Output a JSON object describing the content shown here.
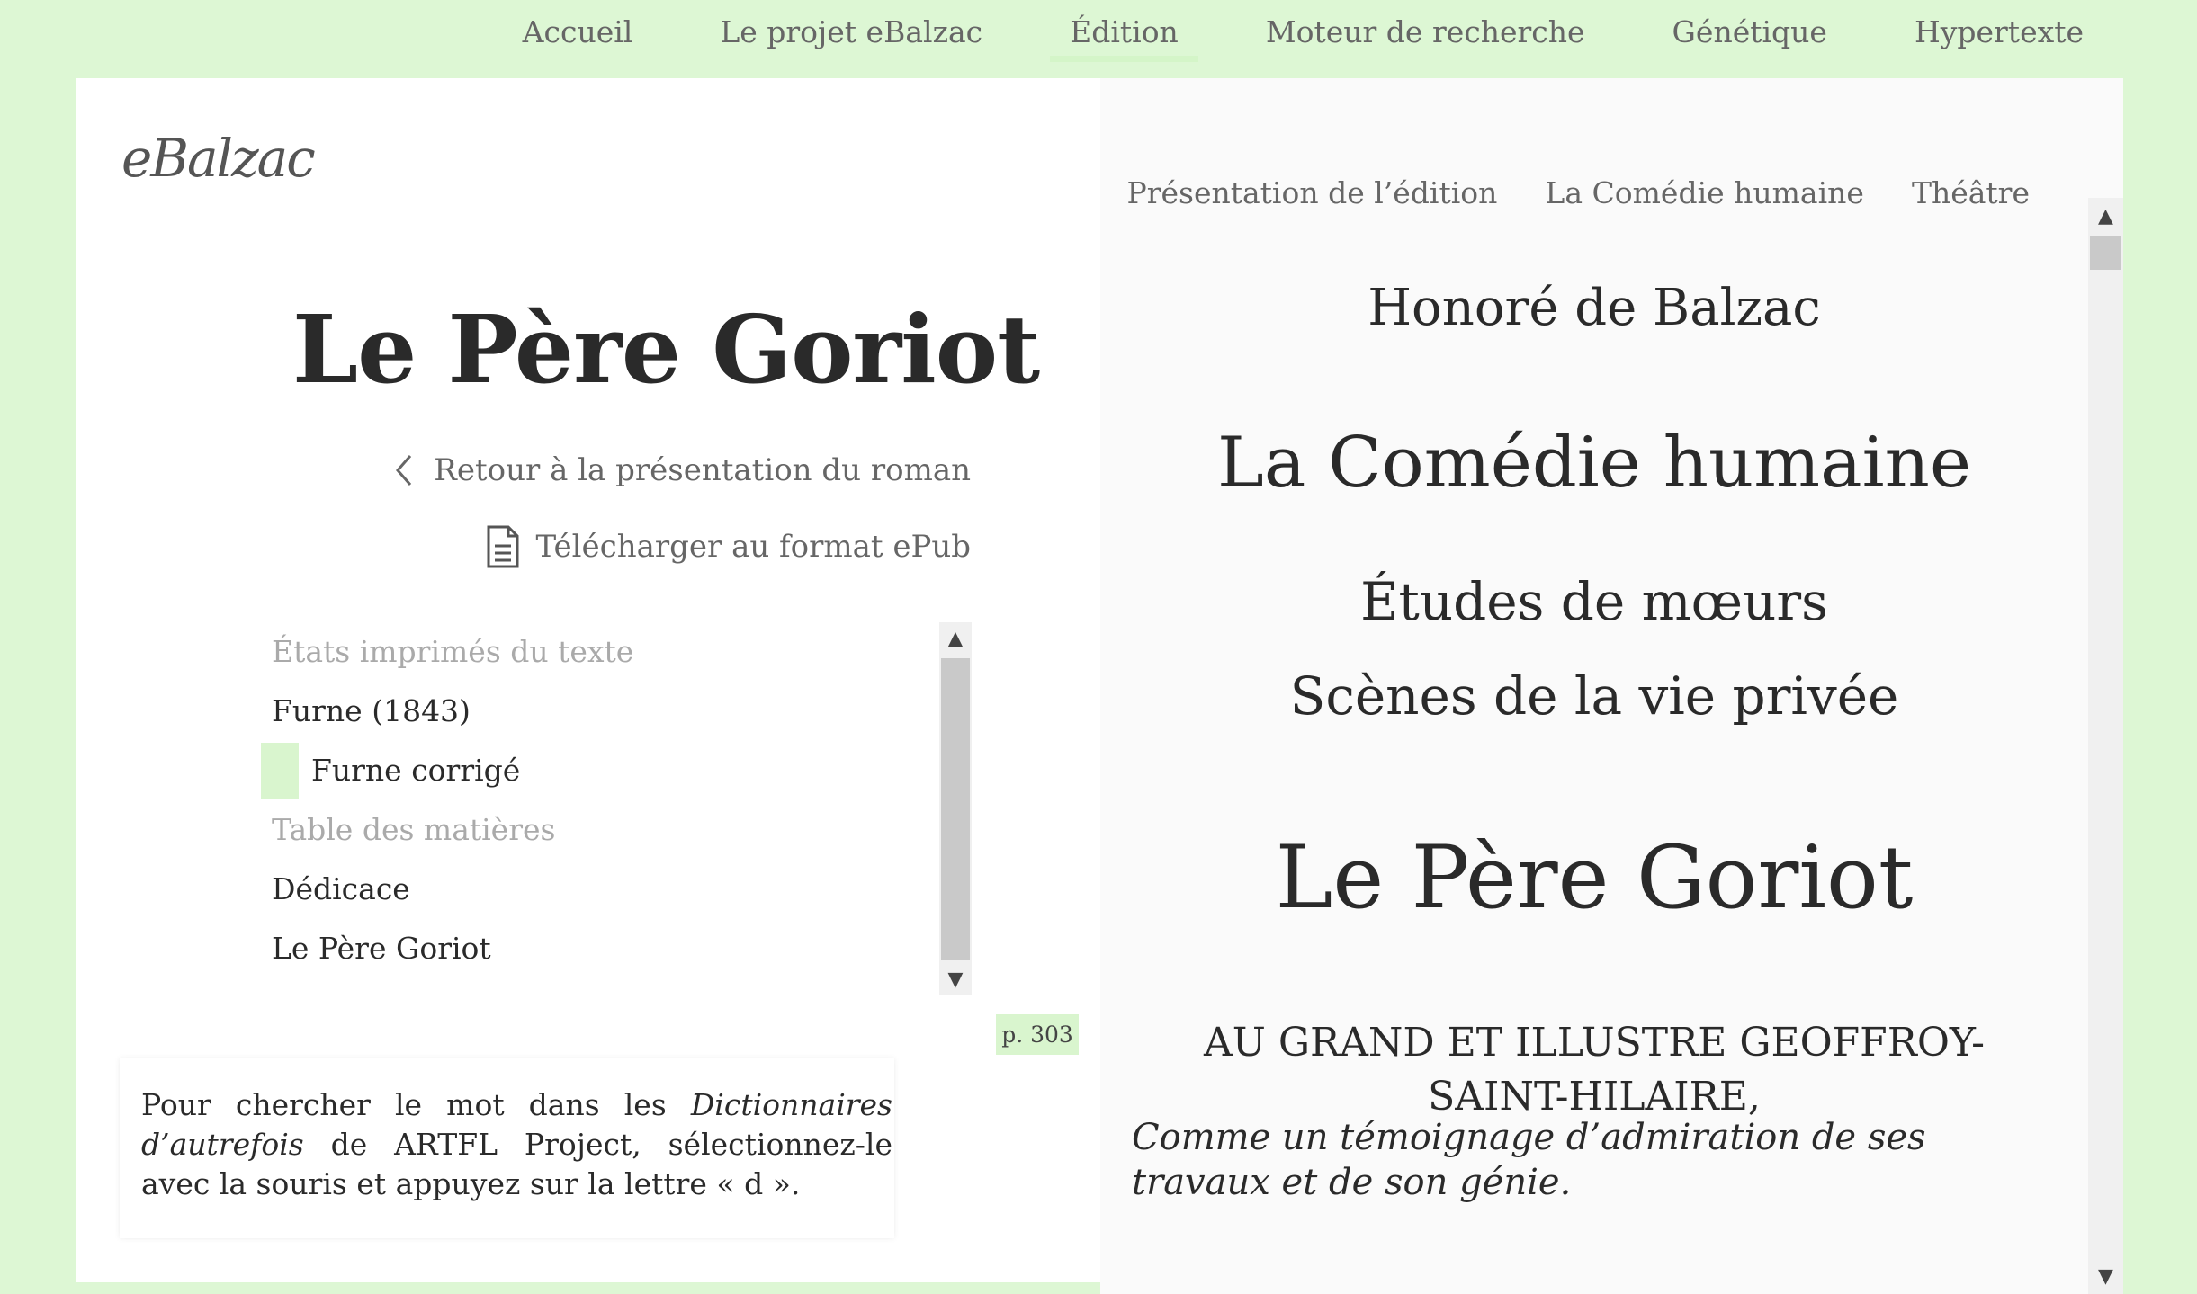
{
  "nav": {
    "items": [
      "Accueil",
      "Le projet eBalzac",
      "Édition",
      "Moteur de recherche",
      "Génétique",
      "Hypertexte"
    ],
    "active": "Édition"
  },
  "subnav": {
    "items": [
      "Présentation de l’édition",
      "La Comédie humaine",
      "Théâtre"
    ]
  },
  "logo": "eBalzac",
  "left": {
    "title": "Le Père Goriot",
    "back_label": "Retour à la présentation du roman",
    "epub_label": "Télécharger au format ePub",
    "toc": {
      "states_heading": "États imprimés du texte",
      "states": [
        "Furne (1843)",
        "Furne corrigé"
      ],
      "contents_heading": "Table des matières",
      "contents": [
        "Dédicace",
        "Le Père Goriot"
      ]
    },
    "page_marker": "p. 303",
    "dict_hint": {
      "part1": "Pour chercher le mot dans les ",
      "italic": "Dictionnaires d’autrefois",
      "part2": " de ARTFL Project, sélectionnez-le avec la souris et appuyez sur la lettre « d »."
    }
  },
  "text": {
    "author": "Honoré de Balzac",
    "collection": "La Comédie humaine",
    "series": "Études de mœurs",
    "subseries": "Scènes de la vie privée",
    "work_title": "Le Père Goriot",
    "dedication_head": "AU GRAND ET ILLUSTRE GEOFFROY-SAINT-HILAIRE,",
    "dedication_text": "Comme un témoignage d’admiration de ses travaux et de son génie."
  },
  "colors": {
    "page_bg": "#ddf7d4",
    "accent": "#d4f5c8"
  }
}
